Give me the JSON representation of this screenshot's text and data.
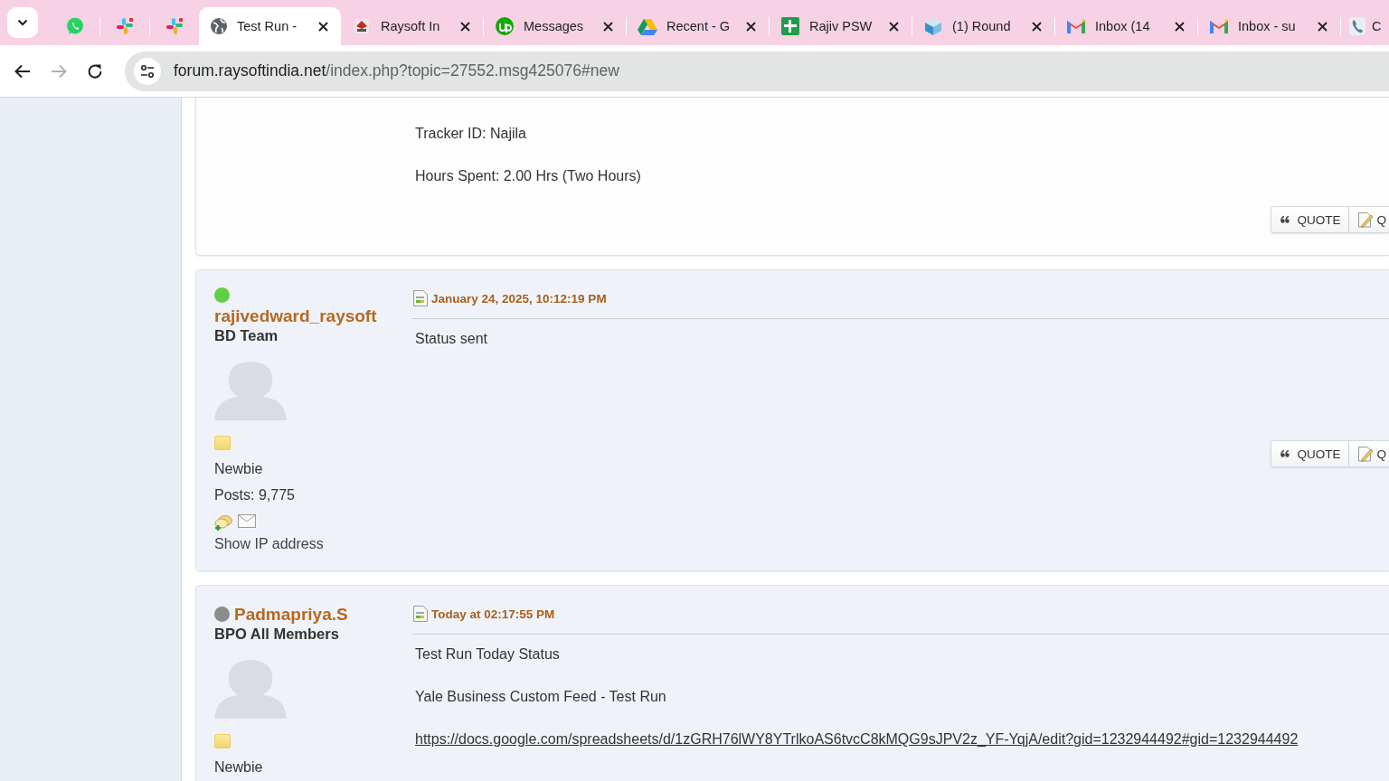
{
  "browser": {
    "tabs": [
      {
        "kind": "pinned",
        "selected": false
      },
      {
        "kind": "pinned",
        "selected": false
      },
      {
        "kind": "pinned",
        "selected": false
      },
      {
        "kind": "normal",
        "title": "Test Run -",
        "selected": true
      },
      {
        "kind": "normal",
        "title": "Raysoft In",
        "selected": false
      },
      {
        "kind": "normal",
        "title": "Messages",
        "selected": false
      },
      {
        "kind": "normal",
        "title": "Recent - G",
        "selected": false
      },
      {
        "kind": "normal",
        "title": "Rajiv PSW",
        "selected": false
      },
      {
        "kind": "normal",
        "title": "(1) Round",
        "selected": false
      },
      {
        "kind": "normal",
        "title": "Inbox (14",
        "selected": false
      },
      {
        "kind": "normal",
        "title": "Inbox - su",
        "selected": false
      },
      {
        "kind": "partial",
        "title": "C",
        "selected": false
      }
    ],
    "forward_disabled": true,
    "address": {
      "host": "forum.raysoftindia.net",
      "path": "/index.php?topic=27552.msg425076#new"
    }
  },
  "posts": [
    {
      "kind": "continued",
      "lines": [
        {
          "kind": "text",
          "text": "Tracker ID: Najila"
        },
        {
          "kind": "text",
          "text": "Hours Spent: 2.00 Hrs (Two Hours)"
        }
      ],
      "buttons": [
        "QUOTE",
        "Q"
      ]
    },
    {
      "kind": "full",
      "online": true,
      "author": "rajivedward_raysoft",
      "group": "BD Team",
      "rank": "Newbie",
      "post_count": "Posts: 9,775",
      "show_ip": "Show IP address",
      "date": "January 24, 2025, 10:12:19 PM",
      "lines": [
        {
          "kind": "text",
          "text": "Status sent"
        }
      ],
      "buttons": [
        "QUOTE",
        "Q"
      ]
    },
    {
      "kind": "full",
      "online": false,
      "author": "Padmapriya.S",
      "group": "BPO All Members",
      "rank": "Newbie",
      "date": "Today at 02:17:55 PM",
      "lines": [
        {
          "kind": "text",
          "text": "Test Run Today Status"
        },
        {
          "kind": "text",
          "text": "Yale Business Custom Feed - Test Run"
        },
        {
          "kind": "link",
          "text": "https://docs.google.com/spreadsheets/d/1zGRH76lWY8YTrlkoAS6tvcC8kMQG9sJPV2z_YF-YqjA/edit?gid=1232944492#gid=1232944492"
        }
      ]
    }
  ]
}
